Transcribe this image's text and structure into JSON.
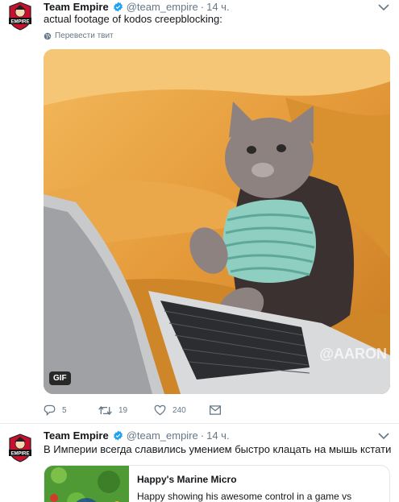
{
  "tweets": [
    {
      "name": "Team Empire",
      "handle": "@team_empire",
      "separator": "·",
      "time": "14 ч.",
      "text": "actual footage of kodos creepblocking:",
      "translate_label": "Перевести твит",
      "media": {
        "type": "gif",
        "badge": "GIF",
        "watermark": "@AARON"
      },
      "actions": {
        "replies": "5",
        "retweets": "19",
        "likes": "240"
      }
    },
    {
      "name": "Team Empire",
      "handle": "@team_empire",
      "separator": "·",
      "time": "14 ч.",
      "text": "В Империи всегда славились умением быстро клацать на мышь кстати",
      "card": {
        "title": "Happy's Marine Micro",
        "description": "Happy showing his awesome control in a game vs"
      }
    }
  ],
  "colors": {
    "verified": "#1da1f2",
    "secondary_text": "#657786",
    "avatar_red": "#c8102e"
  },
  "icons": [
    "empire-logo",
    "verified-badge-icon",
    "chevron-down-icon",
    "globe-icon",
    "reply-icon",
    "retweet-icon",
    "like-icon",
    "dm-icon",
    "play-icon"
  ]
}
